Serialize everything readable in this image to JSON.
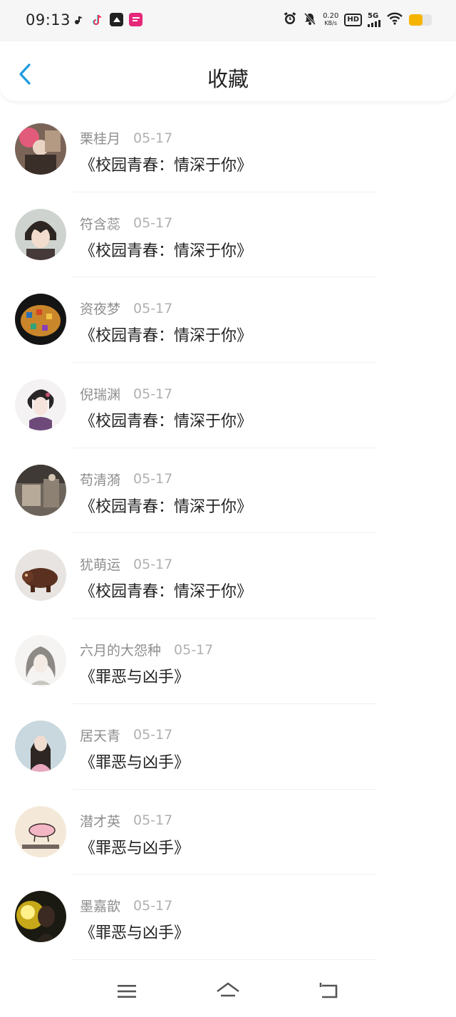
{
  "status_bar": {
    "time": "09:13",
    "net_speed_value": "0.20",
    "net_speed_unit": "KB/s",
    "hd_label": "HD",
    "network_label": "5G",
    "battery_level": 0.6,
    "app_icons": [
      "music-note-icon",
      "tiktok-icon",
      "app-icon",
      "magazine-app-icon"
    ],
    "colors": {
      "battery": "#f5b400"
    }
  },
  "header": {
    "title": "收藏",
    "back_icon": "chevron-left-icon",
    "accent_color": "#1e9be0"
  },
  "favorites": [
    {
      "user": "栗桂月",
      "date": "05-17",
      "book": "《校园青春：情深于你》"
    },
    {
      "user": "符含蕊",
      "date": "05-17",
      "book": "《校园青春：情深于你》"
    },
    {
      "user": "资夜梦",
      "date": "05-17",
      "book": "《校园青春：情深于你》"
    },
    {
      "user": "倪瑞渊",
      "date": "05-17",
      "book": "《校园青春：情深于你》"
    },
    {
      "user": "苟清漪",
      "date": "05-17",
      "book": "《校园青春：情深于你》"
    },
    {
      "user": "犹萌运",
      "date": "05-17",
      "book": "《校园青春：情深于你》"
    },
    {
      "user": "六月的大怨种",
      "date": "05-17",
      "book": "《罪恶与凶手》"
    },
    {
      "user": "居天青",
      "date": "05-17",
      "book": "《罪恶与凶手》"
    },
    {
      "user": "潜才英",
      "date": "05-17",
      "book": "《罪恶与凶手》"
    },
    {
      "user": "墨嘉歆",
      "date": "05-17",
      "book": "《罪恶与凶手》"
    }
  ],
  "bottom_nav": {
    "icons": [
      "menu-icon",
      "home-icon",
      "back-icon"
    ]
  }
}
